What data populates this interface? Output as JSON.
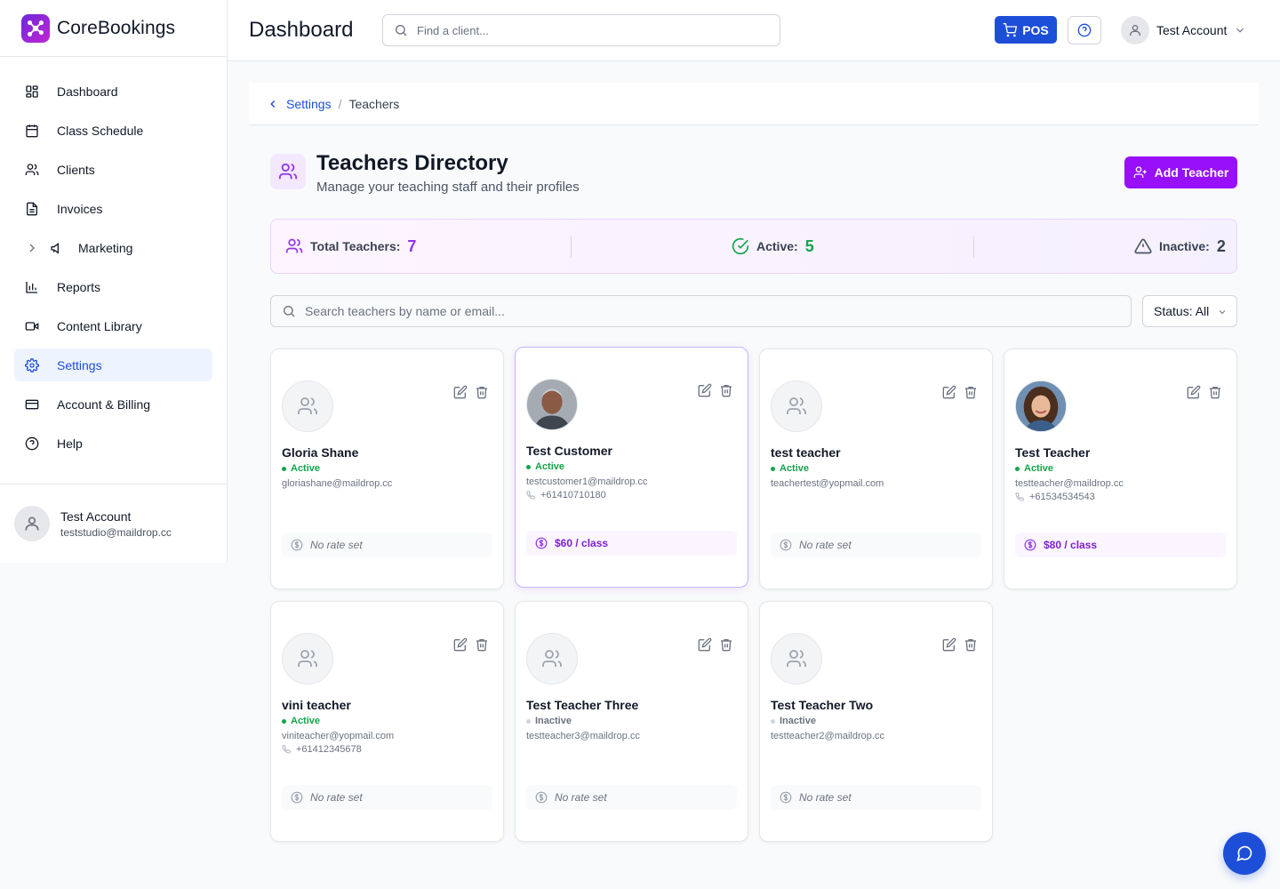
{
  "brand": {
    "name": "CoreBookings"
  },
  "sidebar": {
    "items": [
      {
        "label": "Dashboard",
        "icon": "dashboard-icon"
      },
      {
        "label": "Class Schedule",
        "icon": "calendar-icon"
      },
      {
        "label": "Clients",
        "icon": "users-icon"
      },
      {
        "label": "Invoices",
        "icon": "file-text-icon"
      },
      {
        "label": "Marketing",
        "icon": "megaphone-icon"
      },
      {
        "label": "Reports",
        "icon": "bar-chart-icon"
      },
      {
        "label": "Content Library",
        "icon": "video-icon"
      },
      {
        "label": "Settings",
        "icon": "gear-icon",
        "active": true
      },
      {
        "label": "Account & Billing",
        "icon": "credit-card-icon"
      },
      {
        "label": "Help",
        "icon": "help-circle-icon"
      }
    ],
    "user": {
      "name": "Test Account",
      "email": "teststudio@maildrop.cc"
    }
  },
  "header": {
    "title": "Dashboard",
    "search_placeholder": "Find a client...",
    "pos_label": "POS",
    "account_label": "Test Account"
  },
  "breadcrumb": {
    "parent": "Settings",
    "separator": "/",
    "current": "Teachers"
  },
  "page": {
    "title": "Teachers Directory",
    "subtitle": "Manage your teaching staff and their profiles",
    "add_button": "Add Teacher"
  },
  "stats": {
    "total_label": "Total Teachers:",
    "total_value": "7",
    "active_label": "Active:",
    "active_value": "5",
    "inactive_label": "Inactive:",
    "inactive_value": "2"
  },
  "filters": {
    "search_placeholder": "Search teachers by name or email...",
    "status_value": "Status: All"
  },
  "teachers": [
    {
      "name": "Gloria Shane",
      "status": "Active",
      "email": "gloriashane@maildrop.cc",
      "phone": "",
      "rate": "No rate set"
    },
    {
      "name": "Test Customer",
      "status": "Active",
      "email": "testcustomer1@maildrop.cc",
      "phone": "+61410710180",
      "rate": "$60 / class"
    },
    {
      "name": "test teacher",
      "status": "Active",
      "email": "teachertest@yopmail.com",
      "phone": "",
      "rate": "No rate set"
    },
    {
      "name": "Test Teacher",
      "status": "Active",
      "email": "testteacher@maildrop.cc",
      "phone": "+61534534543",
      "rate": "$80 / class"
    },
    {
      "name": "vini teacher",
      "status": "Active",
      "email": "viniteacher@yopmail.com",
      "phone": "+61412345678",
      "rate": "No rate set"
    },
    {
      "name": "Test Teacher Three",
      "status": "Inactive",
      "email": "testteacher3@maildrop.cc",
      "phone": "",
      "rate": "No rate set"
    },
    {
      "name": "Test Teacher Two",
      "status": "Inactive",
      "email": "testteacher2@maildrop.cc",
      "phone": "",
      "rate": "No rate set"
    }
  ],
  "colors": {
    "primary": "#1d4ed8",
    "accent": "#9810fa",
    "active": "#16a34a"
  }
}
